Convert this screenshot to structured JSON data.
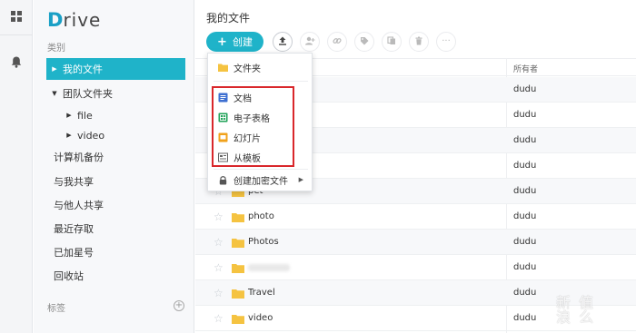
{
  "app": {
    "logo_first": "D",
    "logo_rest": "rive"
  },
  "sidebar": {
    "category_label": "类别",
    "items": [
      {
        "label": "我的文件",
        "active": true
      },
      {
        "label": "团队文件夹"
      },
      {
        "label": "file"
      },
      {
        "label": "video"
      },
      {
        "label": "计算机备份"
      },
      {
        "label": "与我共享"
      },
      {
        "label": "与他人共享"
      },
      {
        "label": "最近存取"
      },
      {
        "label": "已加星号"
      },
      {
        "label": "回收站"
      }
    ],
    "tags_label": "标签",
    "tags_add": "+"
  },
  "main": {
    "title": "我的文件",
    "create_label": "创建",
    "create_plus": "+",
    "owner_header": "所有者",
    "rows": [
      {
        "name": "",
        "owner": "dudu"
      },
      {
        "name": "",
        "owner": "dudu"
      },
      {
        "name": "",
        "owner": "dudu"
      },
      {
        "name": "",
        "owner": "dudu"
      },
      {
        "name": "pet",
        "owner": "dudu"
      },
      {
        "name": "photo",
        "owner": "dudu"
      },
      {
        "name": "Photos",
        "owner": "dudu"
      },
      {
        "name": "",
        "owner": "dudu"
      },
      {
        "name": "Travel",
        "owner": "dudu"
      },
      {
        "name": "video",
        "owner": "dudu"
      }
    ]
  },
  "create_menu": {
    "folder": "文件夹",
    "document": "文档",
    "spreadsheet": "电子表格",
    "slides": "幻灯片",
    "from_template": "从模板",
    "encrypted": "创建加密文件"
  },
  "colors": {
    "accent": "#1fb3c9",
    "folder": "#f5c341",
    "highlight": "#d9272b"
  },
  "watermark": "新 值\n浪 么"
}
